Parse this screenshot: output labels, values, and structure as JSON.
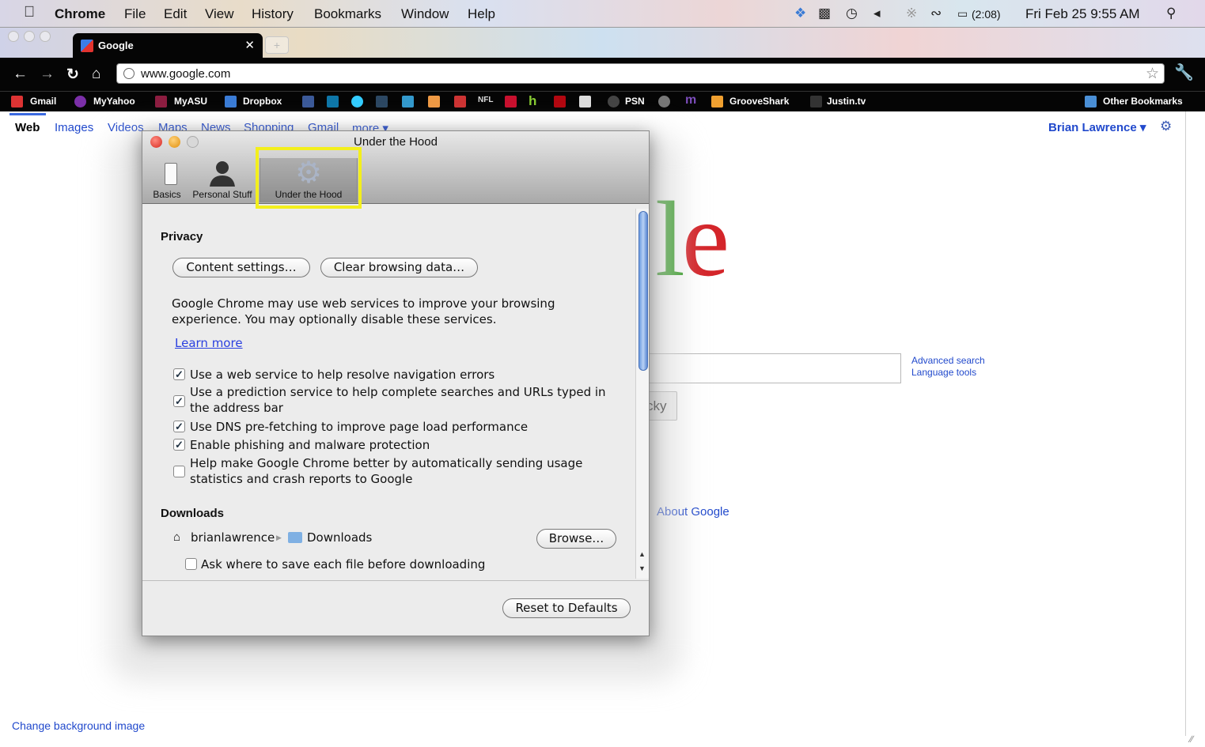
{
  "menubar": {
    "app": "Chrome",
    "items": [
      "File",
      "Edit",
      "View",
      "History",
      "Bookmarks",
      "Window",
      "Help"
    ],
    "battery": "(2:08)",
    "clock": "Fri Feb 25  9:55 AM"
  },
  "browser": {
    "tab_title": "Google",
    "url": "www.google.com"
  },
  "bookmarks": {
    "gmail": "Gmail",
    "myyahoo": "MyYahoo",
    "myasu": "MyASU",
    "dropbox": "Dropbox",
    "psn": "PSN",
    "grooveshark": "GrooveShark",
    "justintv": "Justin.tv",
    "other": "Other Bookmarks",
    "nfl": "NFL"
  },
  "google": {
    "links": [
      "Web",
      "Images",
      "Videos",
      "Maps",
      "News",
      "Shopping",
      "Gmail",
      "more ▾"
    ],
    "user": "Brian Lawrence ▾",
    "logo_fragment": [
      "l",
      "e"
    ],
    "lucky_fragment": "cky",
    "advanced": "Advanced search",
    "language": "Language tools",
    "about": "About Google",
    "change_bg": "Change background image"
  },
  "dialog": {
    "title": "Under the Hood",
    "tabs": [
      "Basics",
      "Personal Stuff",
      "Under the Hood"
    ],
    "privacy": {
      "heading": "Privacy",
      "content_btn": "Content settings…",
      "clear_btn": "Clear browsing data…",
      "desc": "Google Chrome may use web services to improve your browsing experience. You may optionally disable these services.",
      "learn": "Learn more",
      "options": [
        {
          "label": "Use a web service to help resolve navigation errors",
          "checked": true
        },
        {
          "label": "Use a prediction service to help complete searches and URLs typed in the address bar",
          "checked": true
        },
        {
          "label": "Use DNS pre-fetching to improve page load performance",
          "checked": true
        },
        {
          "label": "Enable phishing and malware protection",
          "checked": true
        },
        {
          "label": "Help make Google Chrome better by automatically sending usage statistics and crash reports to Google",
          "checked": false
        }
      ]
    },
    "downloads": {
      "heading": "Downloads",
      "path_user": "brianlawrence",
      "path_folder": "Downloads",
      "browse": "Browse…",
      "ask": "Ask where to save each file before downloading",
      "ask_checked": false
    },
    "reset": "Reset to Defaults"
  },
  "colors": {
    "highlight": "#f3ef1c",
    "link": "#2149cc",
    "thumb": "#6b9ae0"
  }
}
